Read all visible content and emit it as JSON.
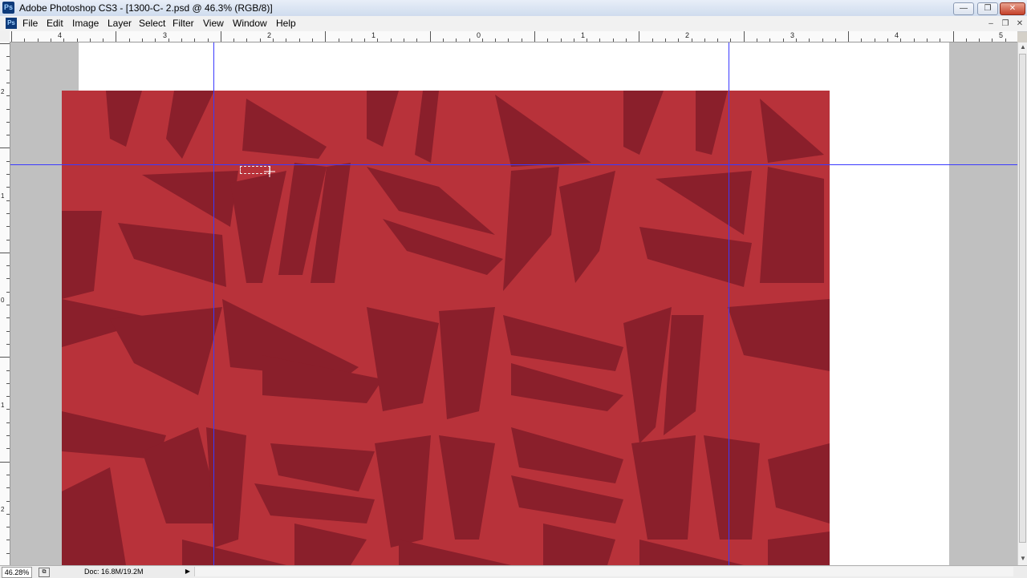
{
  "window": {
    "title": "Adobe Photoshop CS3 - [1300-C- 2.psd @ 46.3% (RGB/8)]",
    "app_icon": "Ps",
    "minimize": "—",
    "restore": "❐",
    "close": "✕"
  },
  "menu": {
    "doc_icon": "Ps",
    "items": [
      "File",
      "Edit",
      "Image",
      "Layer",
      "Select",
      "Filter",
      "View",
      "Window",
      "Help"
    ],
    "mdi_minimize": "–",
    "mdi_restore": "❐",
    "mdi_close": "✕"
  },
  "rulers": {
    "horizontal_labels": [
      "4",
      "3",
      "2",
      "1",
      "0",
      "1",
      "2",
      "3",
      "4",
      "5"
    ],
    "vertical_labels": [
      "2",
      "1",
      "0",
      "1",
      "2"
    ]
  },
  "status": {
    "zoom": "46.28%",
    "doc_info": "Doc: 16.8M/19.2M",
    "arrow": "▶"
  },
  "colors": {
    "fabric_light": "#b8323a",
    "fabric_dark": "#8a1f2b",
    "guide": "#3a3aff"
  }
}
